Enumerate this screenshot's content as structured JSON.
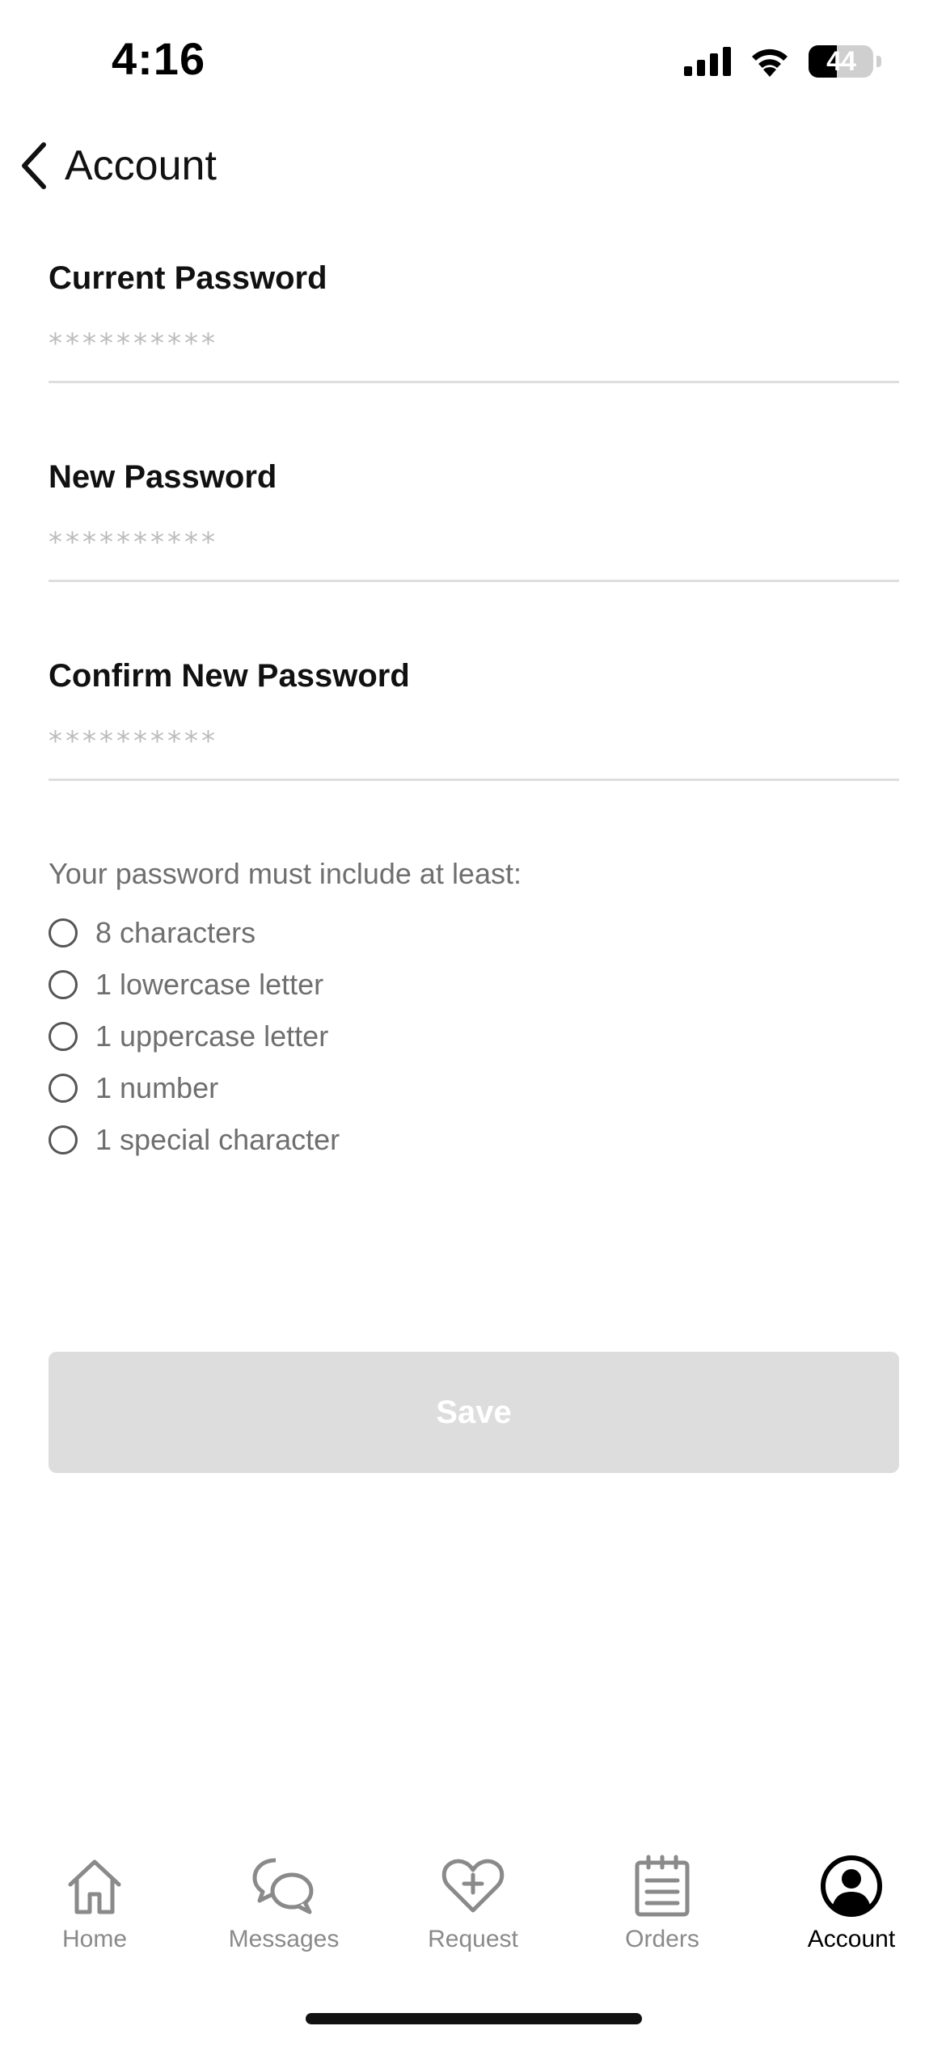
{
  "status_bar": {
    "time": "4:16",
    "battery_level": "44",
    "battery_fraction": 0.44,
    "icons": [
      "signal-icon",
      "wifi-icon",
      "battery-icon"
    ]
  },
  "header": {
    "back_label": "Account"
  },
  "form": {
    "current_password": {
      "label": "Current Password",
      "placeholder": "**********"
    },
    "new_password": {
      "label": "New Password",
      "placeholder": "**********"
    },
    "confirm_password": {
      "label": "Confirm New Password",
      "placeholder": "**********"
    }
  },
  "requirements": {
    "intro": "Your password must include at least:",
    "items": [
      "8 characters",
      "1 lowercase letter",
      "1 uppercase letter",
      "1 number",
      "1 special character"
    ]
  },
  "save_button": {
    "label": "Save",
    "enabled": false
  },
  "tab_bar": {
    "items": [
      {
        "label": "Home",
        "icon": "home-icon"
      },
      {
        "label": "Messages",
        "icon": "messages-icon"
      },
      {
        "label": "Request",
        "icon": "heart-plus-icon"
      },
      {
        "label": "Orders",
        "icon": "clipboard-icon"
      },
      {
        "label": "Account",
        "icon": "account-icon"
      }
    ],
    "active": "Account"
  },
  "colors": {
    "text_primary": "#111111",
    "text_secondary": "#6f6f6f",
    "placeholder": "#bcbcbc",
    "divider": "#dedede",
    "button_disabled_bg": "#dddddd",
    "tab_inactive": "#8a8a8a",
    "tab_active": "#000000"
  }
}
